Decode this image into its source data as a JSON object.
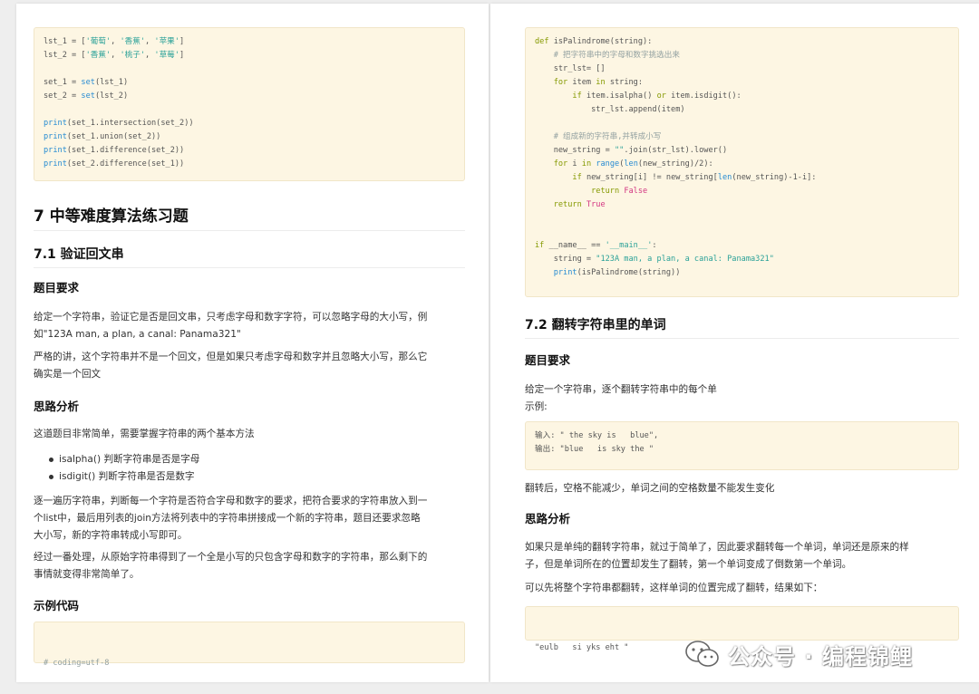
{
  "left": {
    "code_top": [
      "lst_1 = ['葡萄', '香蕉', '苹果']",
      "lst_2 = ['香蕉', '桃子', '草莓']",
      "",
      "set_1 = set(lst_1)",
      "set_2 = set(lst_2)",
      "",
      "print(set_1.intersection(set_2))",
      "print(set_1.union(set_2))",
      "print(set_1.difference(set_2))",
      "print(set_2.difference(set_1))"
    ],
    "h2": "7 中等难度算法练习题",
    "h3": "7.1 验证回文串",
    "req_title": "题目要求",
    "req_p1_a": "给定一个字符串，验证它是否是回文串，只考虑字母和数字字符，可以忽略字母的大小写，例",
    "req_p1_b": "如\"123A man, a plan, a canal: Panama321\"",
    "req_p2_a": "严格的讲，这个字符串并不是一个回文，但是如果只考虑字母和数字并且忽略大小写，那么它",
    "req_p2_b": "确实是一个回文",
    "analysis_title": "思路分析",
    "analysis_p1": "这道题目非常简单，需要掌握字符串的两个基本方法",
    "bullets": [
      "isalpha() 判断字符串是否是字母",
      "isdigit() 判断字符串是否是数字"
    ],
    "analysis_p2_a": "逐一遍历字符串，判断每一个字符是否符合字母和数字的要求，把符合要求的字符串放入到一",
    "analysis_p2_b": "个list中，最后用列表的join方法将列表中的字符串拼接成一个新的字符串，题目还要求忽略",
    "analysis_p2_c": "大小写，新的字符串转成小写即可。",
    "analysis_p3_a": "经过一番处理，从原始字符串得到了一个全是小写的只包含字母和数字的字符串，那么剩下的",
    "analysis_p3_b": "事情就变得非常简单了。",
    "example_title": "示例代码",
    "code_bottom": "# coding=utf-8"
  },
  "right": {
    "code_top": [
      "def isPalindrome(string):",
      "    # 把字符串中的字母和数字挑选出来",
      "    str_lst= []",
      "    for item in string:",
      "        if item.isalpha() or item.isdigit():",
      "            str_lst.append(item)",
      "",
      "    # 组成新的字符串,并转成小写",
      "    new_string = \"\".join(str_lst).lower()",
      "    for i in range(len(new_string)/2):",
      "        if new_string[i] != new_string[len(new_string)-1-i]:",
      "            return False",
      "    return True",
      "",
      "",
      "if __name__ == '__main__':",
      "    string = \"123A man, a plan, a canal: Panama321\"",
      "    print(isPalindrome(string))"
    ],
    "h3": "7.2 翻转字符串里的单词",
    "req_title": "题目要求",
    "req_p1_a": "给定一个字符串，逐个翻转字符串中的每个单",
    "req_p1_b": "示例:",
    "example_code": [
      "输入: \" the sky is   blue\",",
      "输出: \"blue   is sky the \""
    ],
    "req_p2": "翻转后，空格不能减少，单词之间的空格数量不能发生变化",
    "analysis_title": "思路分析",
    "analysis_p1_a": "如果只是单纯的翻转字符串，就过于简单了，因此要求翻转每一个单词，单词还是原来的样",
    "analysis_p1_b": "子，但是单词所在的位置却发生了翻转，第一个单词变成了倒数第一个单词。",
    "analysis_p2": "可以先将整个字符串都翻转，这样单词的位置完成了翻转，结果如下：",
    "result_code": "\"eulb   si yks eht \""
  },
  "watermark": {
    "text": "公众号 · 编程锦鲤",
    "icon": "wechat-icon"
  }
}
